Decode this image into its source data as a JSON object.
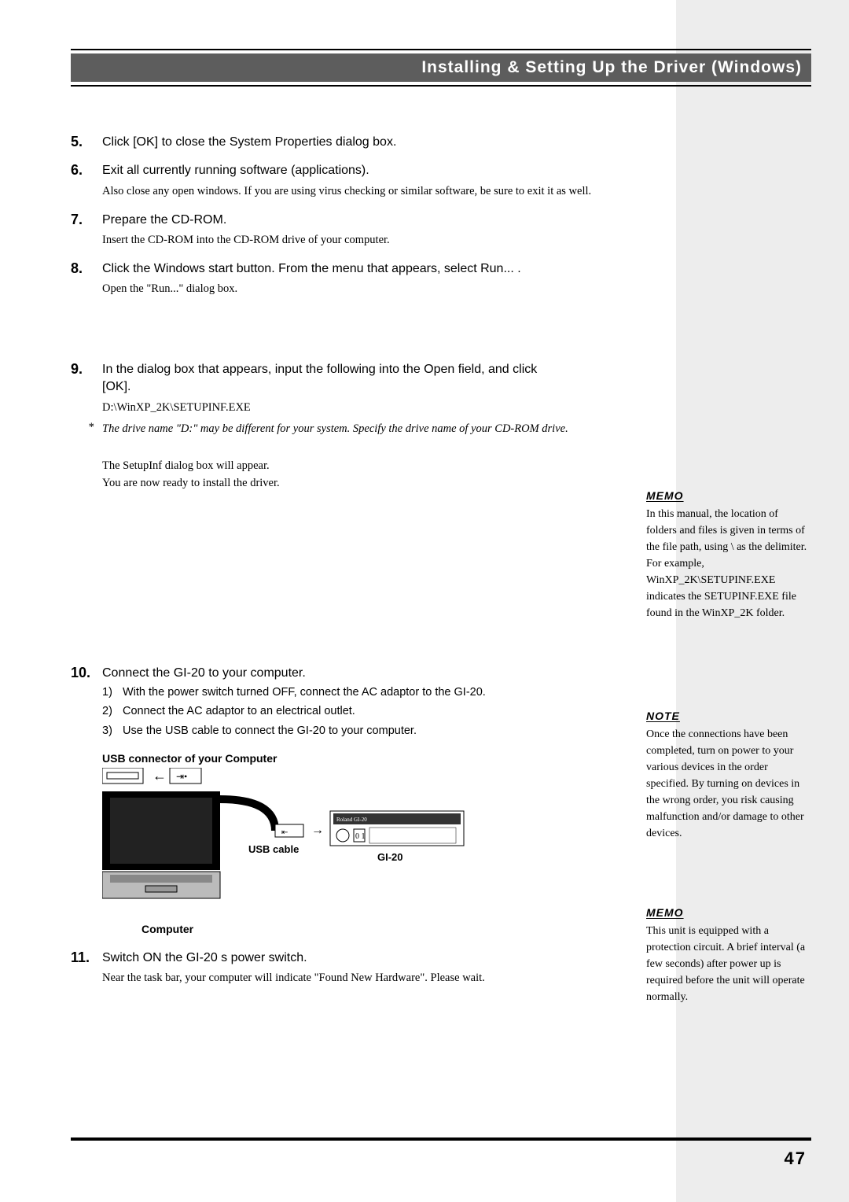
{
  "section_title": "Installing & Setting Up the Driver (Windows)",
  "steps": {
    "s5": {
      "num": "5.",
      "main": "Click [OK] to close the  System Properties  dialog box."
    },
    "s6": {
      "num": "6.",
      "main": "Exit all currently running software (applications).",
      "sub": "Also close any open windows. If you are using virus checking or similar software, be sure to exit it as well."
    },
    "s7": {
      "num": "7.",
      "main": "Prepare the CD-ROM.",
      "sub": "Insert the CD-ROM into the CD-ROM drive of your computer."
    },
    "s8": {
      "num": "8.",
      "main": "Click the Windows  start  button. From the menu that appears, select  Run... .",
      "sub": "Open the \"Run...\" dialog box."
    },
    "s9": {
      "num": "9.",
      "main": "In the dialog box that appears, input the following into the  Open  field, and click [OK].",
      "sub": "D:\\WinXP_2K\\SETUPINF.EXE",
      "note": "The drive name \"D:\" may be different for your system. Specify the drive name of your CD-ROM drive.",
      "after1": "The SetupInf dialog box will appear.",
      "after2": "You are now ready to install the driver."
    },
    "s10": {
      "num": "10.",
      "main": "Connect the GI-20 to your computer.",
      "sub1": "With the power switch turned OFF, connect the AC adaptor to the GI-20.",
      "sub2": "Connect the AC adaptor to an electrical outlet.",
      "sub3": "Use the USB cable to connect the GI-20 to your computer."
    },
    "s11": {
      "num": "11.",
      "main": "Switch ON the GI-20 s power switch.",
      "sub": "Near the task bar, your computer will indicate \"Found New Hardware\". Please wait."
    }
  },
  "diagram": {
    "title": "USB connector of your Computer",
    "usb_cable": "USB cable",
    "gi20": "GI-20",
    "computer": "Computer"
  },
  "sidebar": {
    "memo1": {
      "label": "MEMO",
      "text": "In this manual, the location of folders and files is given in terms of the file path, using \\ as the delimiter. For example, WinXP_2K\\SETUPINF.EXE indicates the SETUPINF.EXE file found in the WinXP_2K folder."
    },
    "note1": {
      "label": "NOTE",
      "text": "Once the connections have been completed, turn on power to your various devices in the order specified. By turning on devices in the wrong order, you risk causing malfunction and/or damage to other devices."
    },
    "memo2": {
      "label": "MEMO",
      "text": "This unit is equipped with a protection circuit. A brief interval (a few seconds) after power up is required before the unit will operate normally."
    }
  },
  "page_num": "47"
}
